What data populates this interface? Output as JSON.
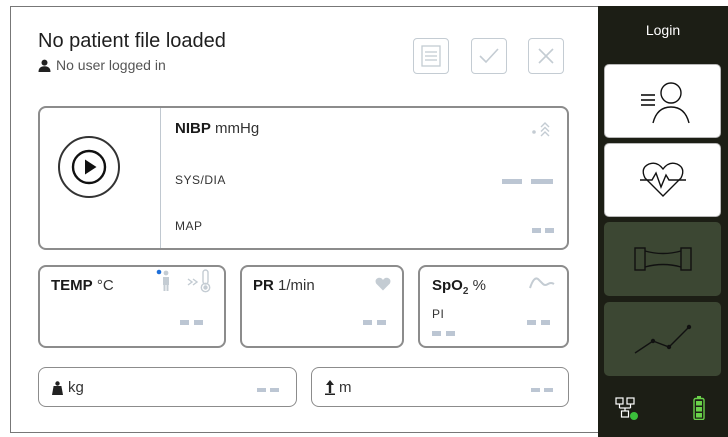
{
  "header": {
    "title": "No patient file loaded",
    "user_status": "No user logged in"
  },
  "toolbar": {
    "list_button": "list-icon",
    "confirm_button": "check-icon",
    "close_button": "close-icon"
  },
  "nibp": {
    "label": "NIBP",
    "unit": "mmHg",
    "sys_dia_label": "SYS/DIA",
    "map_label": "MAP"
  },
  "temp": {
    "label": "TEMP",
    "unit": "°C"
  },
  "pr": {
    "label": "PR",
    "unit": "1/min"
  },
  "spo2": {
    "label": "SpO",
    "subscript": "2",
    "unit": "%",
    "pi_label": "PI"
  },
  "weight": {
    "unit": "kg"
  },
  "height": {
    "unit": "m"
  },
  "sidebar": {
    "login_label": "Login",
    "tabs": [
      "patient-list-tab",
      "vitals-tab",
      "profiles-tab",
      "trend-tab"
    ],
    "status_icons": [
      "network-icon",
      "battery-icon"
    ]
  },
  "colors": {
    "sidebar_bg": "#1c1e15",
    "tab_dark": "#3c4733",
    "accent_blue": "#1e6fd9",
    "dash_placeholder": "#bcc6d3",
    "battery_green": "#6ad24a"
  }
}
